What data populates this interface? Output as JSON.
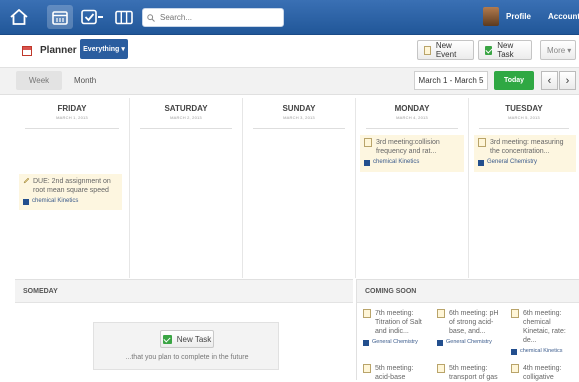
{
  "topbar": {
    "search_placeholder": "Search...",
    "profile": "Profile",
    "account": "Account"
  },
  "planner": {
    "title": "Planner",
    "filter": "Everything",
    "filter_caret": "▾"
  },
  "actions": {
    "new_event": "New Event",
    "new_task": "New Task",
    "more": "More",
    "more_caret": "▾"
  },
  "view": {
    "week": "Week",
    "month": "Month",
    "range": "March 1 - March 5",
    "today": "Today",
    "prev": "‹",
    "next": "›"
  },
  "days": [
    {
      "name": "FRIDAY",
      "date": "MARCH 1, 2013"
    },
    {
      "name": "SATURDAY",
      "date": "MARCH 2, 2013"
    },
    {
      "name": "SUNDAY",
      "date": "MARCH 3, 2013"
    },
    {
      "name": "MONDAY",
      "date": "MARCH 4, 2013"
    },
    {
      "name": "TUESDAY",
      "date": "MARCH 5, 2013"
    }
  ],
  "events": {
    "friday": {
      "title": "DUE: 2nd assignment on root mean square speed",
      "tag": "chemical Kinetics"
    },
    "monday": {
      "title": "3rd meeting:collision frequency and rat...",
      "tag": "chemical Kinetics"
    },
    "tuesday": {
      "title": "3rd meeting: measuring the concentration...",
      "tag": "General Chemistry"
    }
  },
  "someday": {
    "header": "SOMEDAY",
    "button": "New Task",
    "text": "...that you plan to complete in the future"
  },
  "coming_soon": {
    "header": "COMING SOON",
    "items": [
      {
        "title": "7th meeting: Titration of Salt and indic...",
        "tag": "General Chemistry"
      },
      {
        "title": "6th meeting: pH of strong acid-base, and...",
        "tag": "General Chemistry"
      },
      {
        "title": "6th meeting: chemical Kinetaic, rate: de...",
        "tag": "chemical Kinetics"
      },
      {
        "title": "5th meeting: acid-base",
        "tag": ""
      },
      {
        "title": "5th meeting: transport of gas",
        "tag": ""
      },
      {
        "title": "4th meeting: colligative",
        "tag": ""
      }
    ]
  },
  "colors": {
    "topbar": "#2b62a8",
    "accent_blue": "#2a5d9f",
    "today_green": "#2fa843",
    "event_bg": "#fdf6e0",
    "tag_square": "#234f8e"
  }
}
